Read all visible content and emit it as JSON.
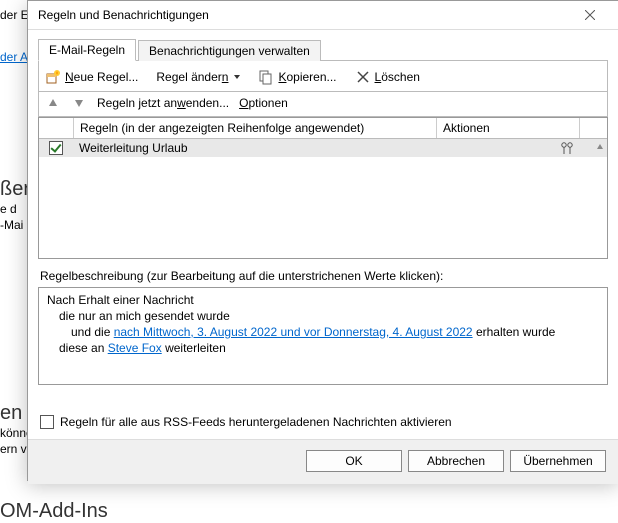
{
  "background": {
    "line1": "der Ein",
    "link": "der A",
    "heading1a": "ßer",
    "heading1b": "e d",
    "heading1c": "-Mai",
    "heading2a": "en",
    "heading2b": "können",
    "heading2c": "ern v",
    "footer": "OM-Add-Ins"
  },
  "dialog": {
    "title": "Regeln und Benachrichtigungen",
    "tabs": {
      "tab1": "E-Mail-Regeln",
      "tab2": "Benachrichtigungen verwalten"
    },
    "toolbar": {
      "new_rule_hot": "N",
      "new_rule_rest": "eue Regel...",
      "change_rule": "Regel änder",
      "change_rule_hot": "n",
      "copy_hot": "K",
      "copy_rest": "opieren...",
      "delete_hot": "L",
      "delete_rest": "öschen"
    },
    "subbar": {
      "run_now": "Regeln jetzt an",
      "run_now_hot": "w",
      "run_now_rest": "enden...",
      "options_hot": "O",
      "options_rest": "ptionen"
    },
    "table": {
      "col_rule": "Regeln (in der angezeigten Reihenfolge angewendet)",
      "col_actions": "Aktionen",
      "rows": [
        {
          "checked": true,
          "name": "Weiterleitung Urlaub"
        }
      ]
    },
    "desc": {
      "label": "Regelbeschreibung (zur Bearbeitung auf die unterstrichenen Werte klicken):",
      "line1": "Nach Erhalt einer Nachricht",
      "line2": "die nur an mich gesendet wurde",
      "line3_pre": "und die ",
      "line3_link": "nach Mittwoch, 3. August 2022 und vor Donnerstag, 4. August 2022",
      "line3_post": " erhalten wurde",
      "line4_pre": "diese an ",
      "line4_link": "Steve Fox",
      "line4_post": " weiterleiten"
    },
    "rss_checkbox": "Regeln für alle aus RSS-Feeds heruntergeladenen Nachrichten aktivieren",
    "buttons": {
      "ok": "OK",
      "cancel": "Abbrechen",
      "apply": "Übernehmen"
    }
  }
}
